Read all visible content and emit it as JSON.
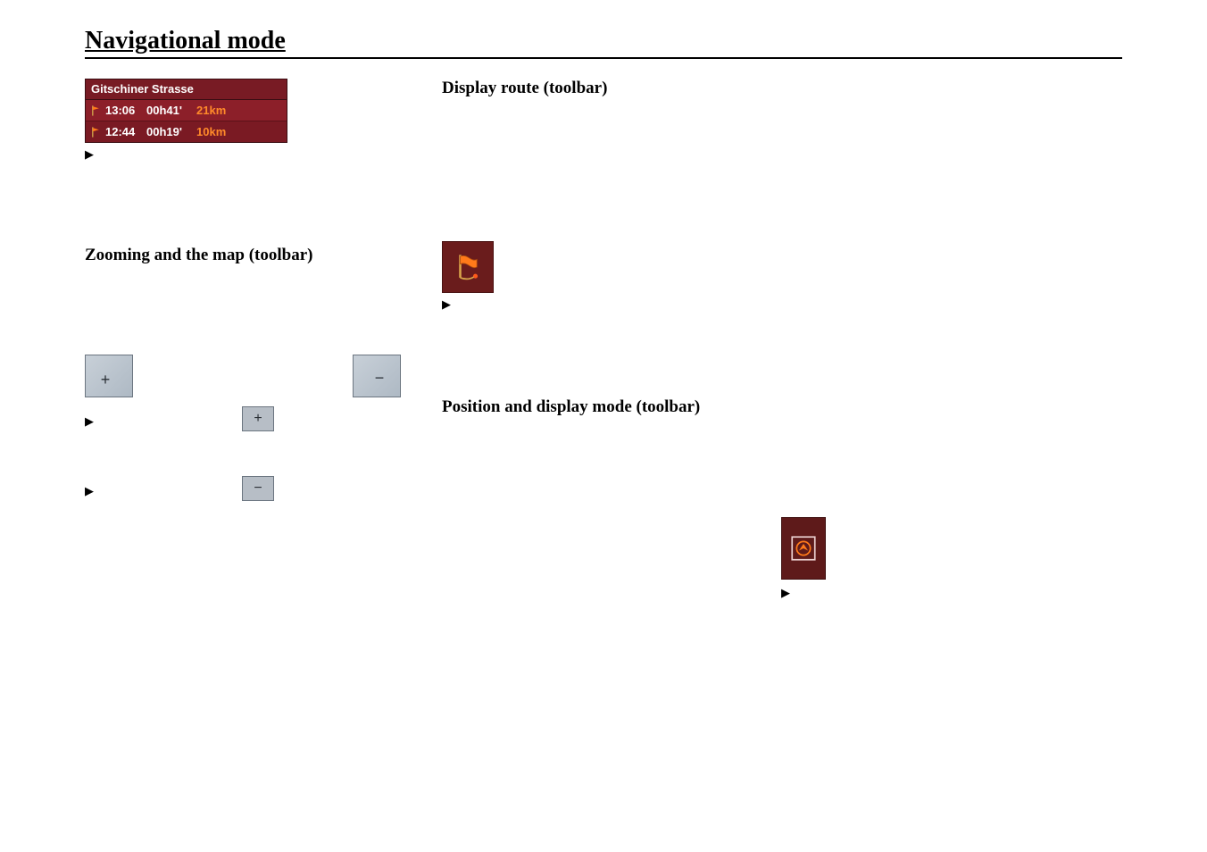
{
  "page": {
    "title": "Navigational mode"
  },
  "route_panel": {
    "header": "Gitschiner Strasse",
    "rows": [
      {
        "time": "13:06",
        "duration": "00h41'",
        "distance": "21km"
      },
      {
        "time": "12:44",
        "duration": "00h19'",
        "distance": "10km"
      }
    ]
  },
  "sections": {
    "zoom": {
      "heading": "Zooming and the map (toolbar)"
    },
    "display": {
      "heading": "Display route (toolbar)"
    },
    "position": {
      "heading": "Position and display mode (toolbar)"
    }
  },
  "glyphs": {
    "arrow": "▶",
    "plus": "+",
    "minus": "−"
  },
  "icons": {
    "zoom_in_large": "zoom-in-icon",
    "zoom_out_large": "zoom-out-icon",
    "zoom_in_small": "zoom-in-icon",
    "zoom_out_small": "zoom-out-icon",
    "route_flag": "route-flag-icon",
    "position_target": "position-target-icon"
  }
}
